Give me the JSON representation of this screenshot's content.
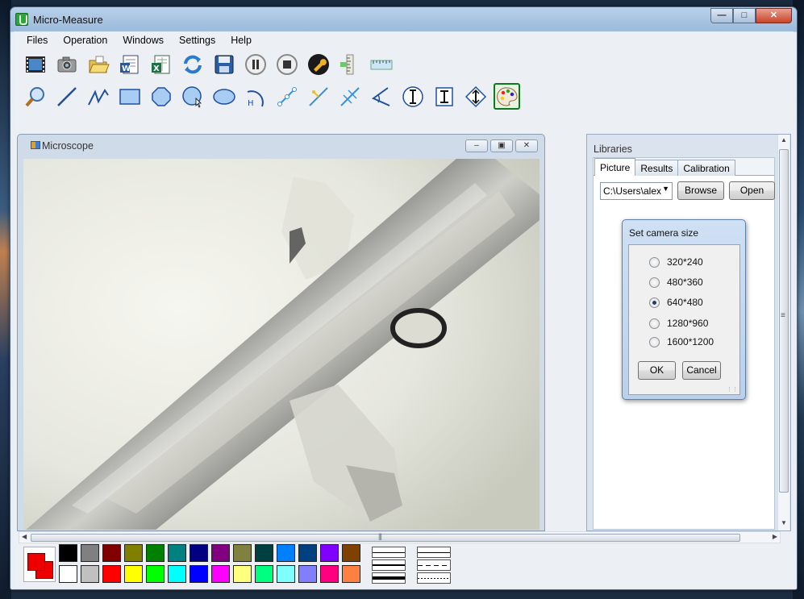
{
  "window": {
    "title": "Micro-Measure"
  },
  "menu": [
    "Files",
    "Operation",
    "Windows",
    "Settings",
    "Help"
  ],
  "toolbar1": [
    {
      "name": "video-icon"
    },
    {
      "name": "camera-icon"
    },
    {
      "name": "open-folder-icon"
    },
    {
      "name": "word-export-icon"
    },
    {
      "name": "excel-export-icon"
    },
    {
      "name": "refresh-icon"
    },
    {
      "name": "save-icon"
    },
    {
      "name": "pause-icon"
    },
    {
      "name": "stop-icon"
    },
    {
      "name": "wrench-icon"
    },
    {
      "name": "ruler-vertical-icon"
    },
    {
      "name": "ruler-horizontal-icon"
    }
  ],
  "toolbar2": [
    {
      "name": "zoom-icon"
    },
    {
      "name": "line-tool-icon"
    },
    {
      "name": "polyline-tool-icon"
    },
    {
      "name": "rectangle-tool-icon"
    },
    {
      "name": "polygon-tool-icon"
    },
    {
      "name": "circle-tool-icon"
    },
    {
      "name": "ellipse-tool-icon"
    },
    {
      "name": "arc-tool-icon"
    },
    {
      "name": "distance-tool-icon"
    },
    {
      "name": "point-line-tool-icon"
    },
    {
      "name": "parallel-tool-icon"
    },
    {
      "name": "angle-tool-icon"
    },
    {
      "name": "vertical-measure-icon"
    },
    {
      "name": "text-tool-icon"
    },
    {
      "name": "diamond-measure-icon"
    },
    {
      "name": "color-palette-icon"
    }
  ],
  "microscope": {
    "title": "Microscope"
  },
  "libraries": {
    "title": "Libraries",
    "tabs": [
      "Picture",
      "Results",
      "Calibration"
    ],
    "path": "C:\\Users\\alex",
    "browse_label": "Browse",
    "open_label": "Open"
  },
  "dialog": {
    "title": "Set camera size",
    "options": [
      "320*240",
      "480*360",
      "640*480",
      "1280*960",
      "1600*1200"
    ],
    "selected": "640*480",
    "ok_label": "OK",
    "cancel_label": "Cancel"
  },
  "palette": {
    "current_fg": "#ee0000",
    "current_bg": "#ee0000",
    "colors": [
      "#000000",
      "#808080",
      "#800000",
      "#808000",
      "#008000",
      "#008080",
      "#000080",
      "#800080",
      "#808040",
      "#004040",
      "#0080ff",
      "#004080",
      "#8000ff",
      "#804000",
      "#ffffff",
      "#c0c0c0",
      "#ff0000",
      "#ffff00",
      "#00ff00",
      "#00ffff",
      "#0000ff",
      "#ff00ff",
      "#ffff80",
      "#00ff80",
      "#80ffff",
      "#8080ff",
      "#ff0080",
      "#ff8040"
    ]
  }
}
